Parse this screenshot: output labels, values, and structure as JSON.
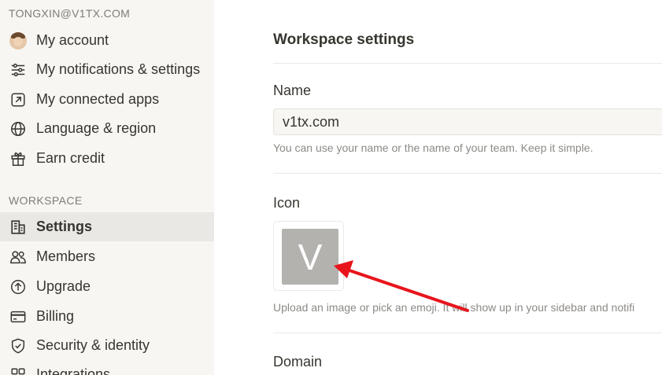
{
  "sidebar": {
    "account_email": "TONGXIN@V1TX.COM",
    "account_items": [
      {
        "label": "My account",
        "icon": "avatar"
      },
      {
        "label": "My notifications & settings",
        "icon": "sliders-icon"
      },
      {
        "label": "My connected apps",
        "icon": "external-link-icon"
      },
      {
        "label": "Language & region",
        "icon": "globe-icon"
      },
      {
        "label": "Earn credit",
        "icon": "gift-icon"
      }
    ],
    "workspace_header": "WORKSPACE",
    "workspace_items": [
      {
        "label": "Settings",
        "icon": "building-icon",
        "active": true
      },
      {
        "label": "Members",
        "icon": "people-icon"
      },
      {
        "label": "Upgrade",
        "icon": "upgrade-arrow-icon"
      },
      {
        "label": "Billing",
        "icon": "credit-card-icon"
      },
      {
        "label": "Security & identity",
        "icon": "shield-check-icon"
      },
      {
        "label": "Integrations",
        "icon": "grid-icon"
      }
    ]
  },
  "main": {
    "title": "Workspace settings",
    "name_section": {
      "label": "Name",
      "value": "v1tx.com",
      "help": "You can use your name or the name of your team. Keep it simple."
    },
    "icon_section": {
      "label": "Icon",
      "icon_letter": "V",
      "help": "Upload an image or pick an emoji. It will show up in your sidebar and notifi"
    },
    "domain_section": {
      "label": "Domain"
    }
  },
  "colors": {
    "sidebar_bg": "#f7f6f3",
    "active_item_bg": "#e9e8e4",
    "text": "#37352f",
    "muted_text": "#7d7c78",
    "icon_tile": "#b3b2af",
    "annotation_arrow": "#e8141c"
  }
}
